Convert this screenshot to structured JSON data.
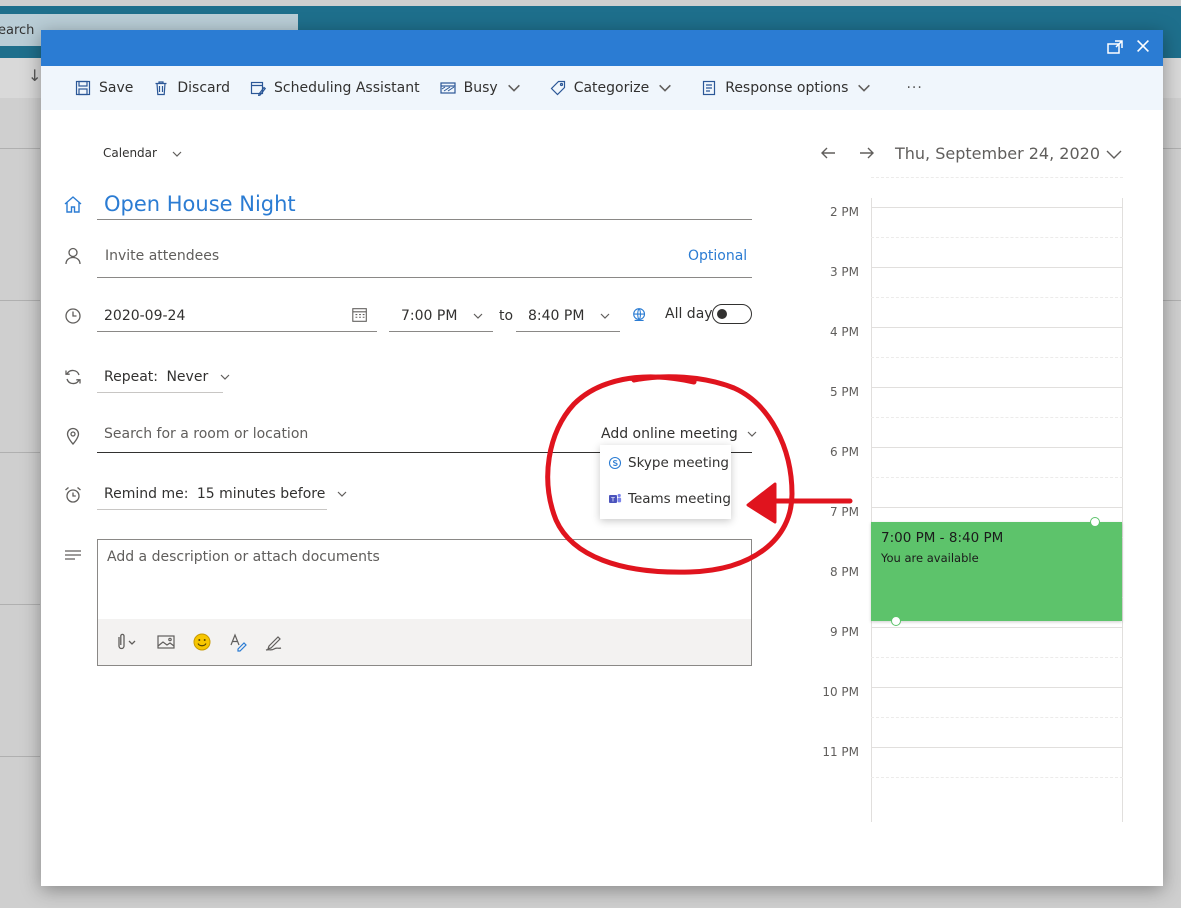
{
  "background": {
    "search_text": "earch"
  },
  "toolbar": {
    "save": "Save",
    "discard": "Discard",
    "scheduling_assistant": "Scheduling Assistant",
    "busy": "Busy",
    "categorize": "Categorize",
    "response_options": "Response options",
    "more": "···"
  },
  "form": {
    "calendar_label": "Calendar",
    "title": "Open House Night",
    "attendees_placeholder": "Invite attendees",
    "optional_label": "Optional",
    "date": "2020-09-24",
    "start_time": "7:00 PM",
    "to_label": "to",
    "end_time": "8:40 PM",
    "all_day_label": "All day",
    "all_day_on": false,
    "repeat_label": "Repeat:",
    "repeat_value": "Never",
    "location_placeholder": "Search for a room or location",
    "online_meeting_label": "Add online meeting",
    "online_menu": [
      "Skype meeting",
      "Teams meeting"
    ],
    "remind_label": "Remind me:",
    "remind_value": "15 minutes before",
    "description_placeholder": "Add a description or attach documents"
  },
  "calendar": {
    "date": "Thu, September 24, 2020",
    "hours": [
      "2 PM",
      "3 PM",
      "4 PM",
      "5 PM",
      "6 PM",
      "7 PM",
      "8 PM",
      "9 PM",
      "10 PM",
      "11 PM"
    ],
    "event": {
      "time": "7:00 PM - 8:40 PM",
      "status": "You are available",
      "color": "#5dc36b"
    }
  },
  "colors": {
    "accent": "#2b7cd3",
    "annotation": "#e0141e"
  }
}
